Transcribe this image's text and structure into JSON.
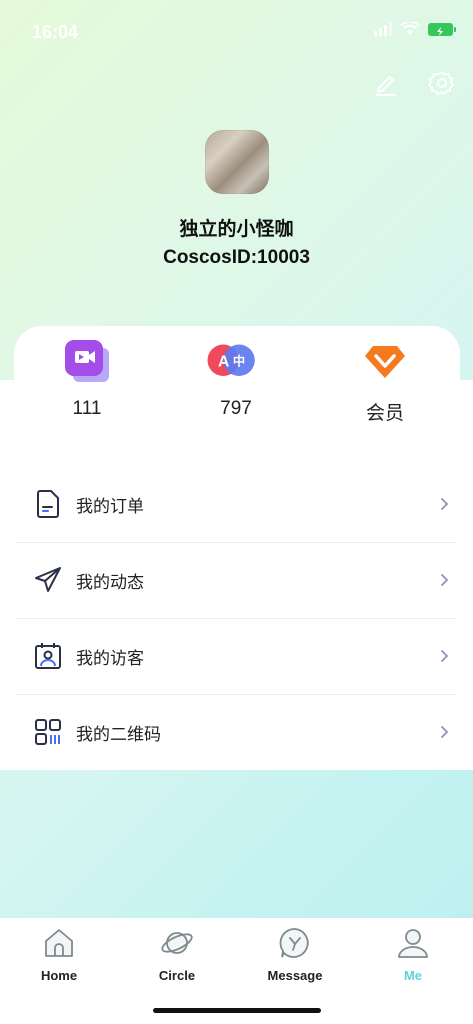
{
  "status": {
    "time": "16:04"
  },
  "profile": {
    "name": "独立的小怪咖",
    "id_label": "CoscosID:10003"
  },
  "stats": [
    {
      "icon": "video-icon",
      "value": "111"
    },
    {
      "icon": "translate-icon",
      "value": "797"
    },
    {
      "icon": "vip-diamond-icon",
      "value": "会员"
    }
  ],
  "menu": [
    {
      "icon": "order-document-icon",
      "label": "我的订单"
    },
    {
      "icon": "paper-plane-icon",
      "label": "我的动态"
    },
    {
      "icon": "visitor-calendar-icon",
      "label": "我的访客"
    },
    {
      "icon": "qr-code-icon",
      "label": "我的二维码"
    }
  ],
  "tabs": [
    {
      "icon": "home-icon",
      "label": "Home",
      "active": false
    },
    {
      "icon": "planet-icon",
      "label": "Circle",
      "active": false
    },
    {
      "icon": "message-icon",
      "label": "Message",
      "active": false
    },
    {
      "icon": "profile-icon",
      "label": "Me",
      "active": true
    }
  ],
  "colors": {
    "accent": "#5fd3d9",
    "battery": "#34c759"
  }
}
